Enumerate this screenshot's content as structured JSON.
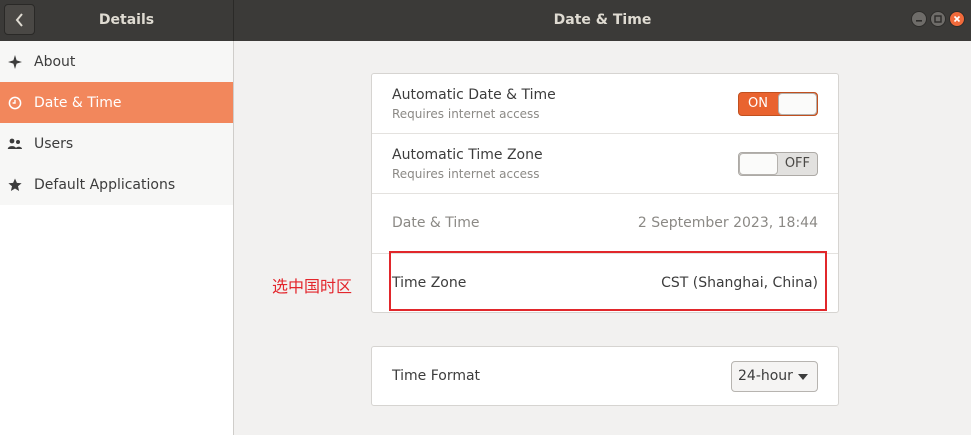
{
  "titlebar": {
    "left_title": "Details",
    "right_title": "Date & Time"
  },
  "sidebar": {
    "items": [
      {
        "label": "About",
        "icon": "sparkle-icon"
      },
      {
        "label": "Date & Time",
        "icon": "clock-icon",
        "active": true
      },
      {
        "label": "Users",
        "icon": "users-icon"
      },
      {
        "label": "Default Applications",
        "icon": "star-icon"
      }
    ]
  },
  "settings": {
    "auto_datetime": {
      "title": "Automatic Date & Time",
      "subtitle": "Requires internet access",
      "state": "ON"
    },
    "auto_timezone": {
      "title": "Automatic Time Zone",
      "subtitle": "Requires internet access",
      "state": "OFF"
    },
    "datetime": {
      "title": "Date & Time",
      "value": "2 September 2023, 18:44"
    },
    "timezone": {
      "title": "Time Zone",
      "value": "CST (Shanghai, China)"
    },
    "time_format": {
      "title": "Time Format",
      "value": "24-hour"
    }
  },
  "annotation": {
    "text": "选中国时区",
    "color": "#e1272b"
  },
  "colors": {
    "accent": "#e9632f",
    "sidebar_active": "#f2875c",
    "titlebar": "#3b3a38"
  }
}
